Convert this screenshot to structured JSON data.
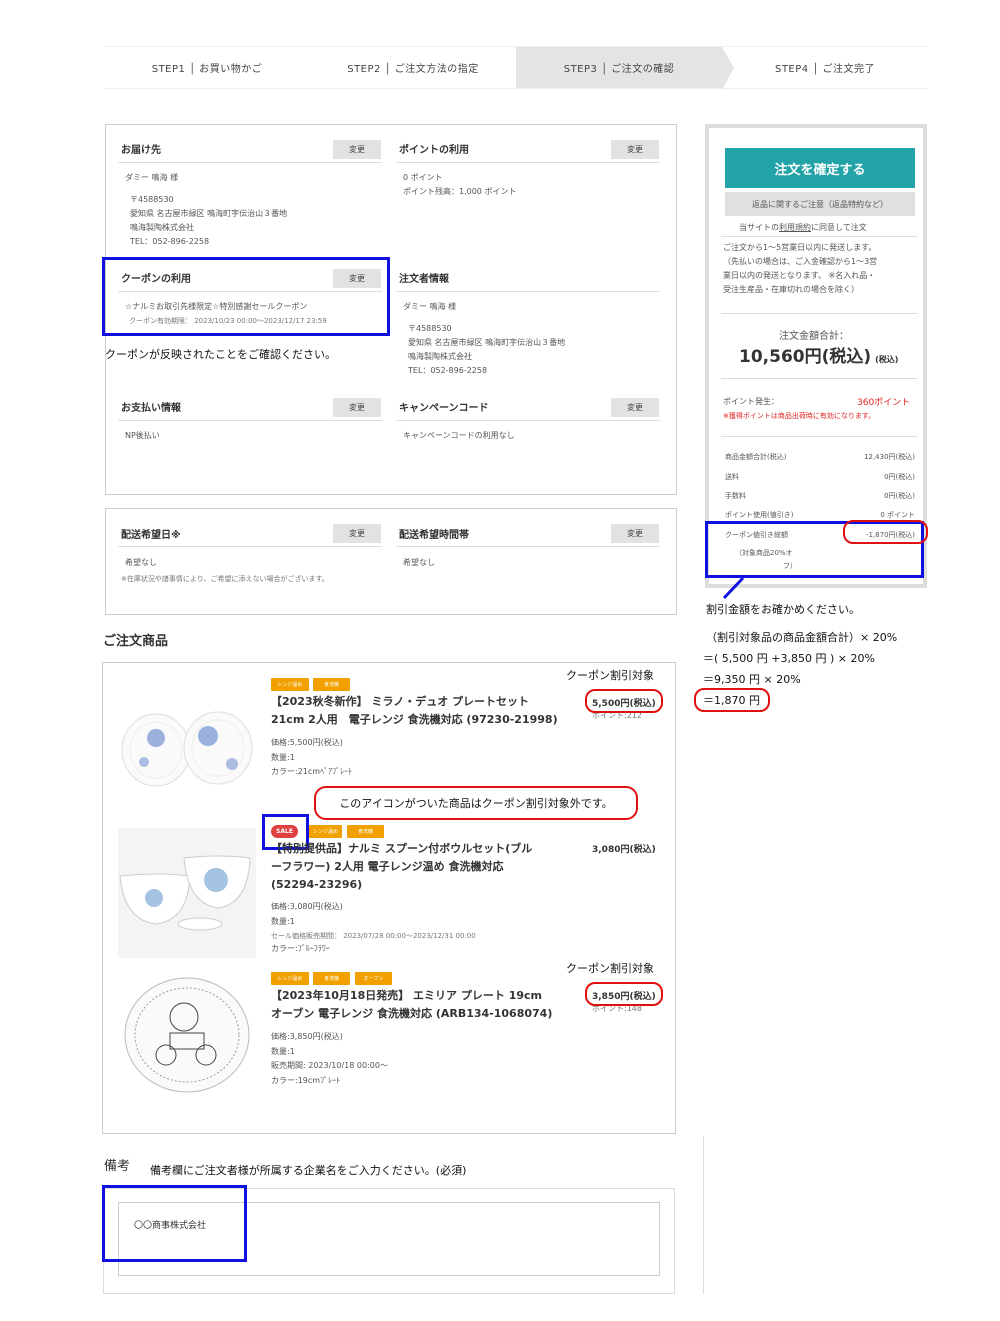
{
  "steps": [
    {
      "label": "STEP1 │ お買い物かご"
    },
    {
      "label": "STEP2 │ ご注文方法の指定"
    },
    {
      "label": "STEP3 │ ご注文の確認"
    },
    {
      "label": "STEP4 │ ご注文完了"
    }
  ],
  "change_label": "変更",
  "delivery": {
    "title": "お届け先",
    "name": "ダミー 鳴海 様",
    "postal": "〒4588530",
    "address": "愛知県 名古屋市緑区 鳴海町字伝治山３番地",
    "company": "鳴海製陶株式会社",
    "tel": "TEL：052-896-2258"
  },
  "points": {
    "title": "ポイントの利用",
    "used": "0 ポイント",
    "balance": "ポイント残高：1,000 ポイント"
  },
  "coupon": {
    "title": "クーポンの利用",
    "name": "☆ナルミお取引先様限定☆特別感謝セールクーポン",
    "period": "クーポン有効期限： 2023/10/23 00:00～2023/12/17 23:59",
    "note": "クーポンが反映されたことをご確認ください。"
  },
  "orderer": {
    "title": "注文者情報",
    "name": "ダミー 鳴海 様",
    "postal": "〒4588530",
    "address": "愛知県 名古屋市緑区 鳴海町字伝治山３番地",
    "company": "鳴海製陶株式会社",
    "tel": "TEL：052-896-2258"
  },
  "payment": {
    "title": "お支払い情報",
    "value": "NP後払い"
  },
  "campaign": {
    "title": "キャンペーンコード",
    "value": "キャンペーンコードの利用なし"
  },
  "delivery_date": {
    "title": "配送希望日※",
    "value": "希望なし",
    "note": "※在庫状況や諸事情により、ご希望に添えない場合がございます。"
  },
  "delivery_time": {
    "title": "配送希望時間帯",
    "value": "希望なし"
  },
  "panel": {
    "confirm_label": "注文を確定する",
    "return_label": "返品に関するご注意（返品特約など）",
    "terms_prefix": "当サイトの",
    "terms_link": "利用規約",
    "terms_suffix": "に同意して注文",
    "shipping_note_1": "ご注文から1～5営業日以内に発送します。",
    "shipping_note_2": "（先払いの場合は、ご入金確認から1～3営",
    "shipping_note_3": "業日以内の発送となります。 ※名入れ品・",
    "shipping_note_4": "受注生産品・在庫切れの場合を除く）",
    "total_label": "注文金額合計：",
    "total_value": "10,560円(税込)",
    "total_tax": "(税込)",
    "points_label": "ポイント発生：",
    "points_value": "360ポイント",
    "points_note": "※獲得ポイントは商品出荷時に有効になります。",
    "summary": [
      {
        "label": "商品金額合計(税込)",
        "value": "12,430円(税込)"
      },
      {
        "label": "送料",
        "value": "0円(税込)"
      },
      {
        "label": "手数料",
        "value": "0円(税込)"
      },
      {
        "label": "ポイント使用(値引き)",
        "value": "0 ポイント"
      },
      {
        "label": "クーポン値引き総額",
        "value": "-1,870円(税込)"
      }
    ],
    "coupon_detail_1": "（対象商品20%オ",
    "coupon_detail_2": "フ）"
  },
  "calc": {
    "title": "割引金額をお確かめください。",
    "line1": "（割引対象品の商品金額合計）× 20%",
    "line2": "＝( 5,500 円 +3,850 円 ) × 20%",
    "line3": "＝9,350 円 × 20%",
    "line4": "＝1,870 円"
  },
  "products_title": "ご注文商品",
  "coupon_target_label": "クーポン割引対象",
  "callout_text": "このアイコンがついた商品はクーポン割引対象外です。",
  "products": [
    {
      "badges": [
        "レンジ温め",
        "食洗機"
      ],
      "title_1": "【2023秋冬新作】 ミラノ・デュオ プレートセット",
      "title_2": "21cm 2人用　電子レンジ 食洗機対応 (97230-21998)",
      "price": "5,500円(税込)",
      "points": "ポイント:212",
      "meta": [
        "価格:5,500円(税込)",
        "数量:1",
        "カラー:21cmﾍﾟｱﾌﾟﾚｰﾄ"
      ]
    },
    {
      "sale": "SALE",
      "badges": [
        "レンジ温め",
        "食洗機"
      ],
      "title_1": "【特別提供品】ナルミ スプーン付ボウルセット(ブル",
      "title_2": "ーフラワー) 2人用 電子レンジ温め 食洗機対応",
      "title_3": "(52294-23296)",
      "price": "3,080円(税込)",
      "meta": [
        "価格:3,080円(税込)",
        "数量:1"
      ],
      "sale_period": "セール価格販売期間： 2023/07/28 00:00～2023/12/31 00:00",
      "color": "カラー:ﾌﾞﾙｰﾌﾗﾜｰ"
    },
    {
      "badges": [
        "レンジ温め",
        "食洗機",
        "オーブン"
      ],
      "title_1": "【2023年10月18日発売】 エミリア プレート 19cm",
      "title_2": "オーブン 電子レンジ 食洗機対応 (ARB134-1068074)",
      "price": "3,850円(税込)",
      "points": "ポイント:148",
      "meta": [
        "価格:3,850円(税込)",
        "数量:1",
        "販売期間: 2023/10/18 00:00～",
        "カラー:19cmﾌﾟﾚｰﾄ"
      ]
    }
  ],
  "remarks": {
    "title": "備考",
    "instruction": "備考欄にご注文者様が所属する企業名をご入力ください。(必須)",
    "value": "〇〇商事株式会社"
  },
  "colors": {
    "accent": "#22a3a8",
    "highlight_blue": "#1010e0",
    "highlight_red": "#e01010",
    "badge": "#f2a000"
  }
}
